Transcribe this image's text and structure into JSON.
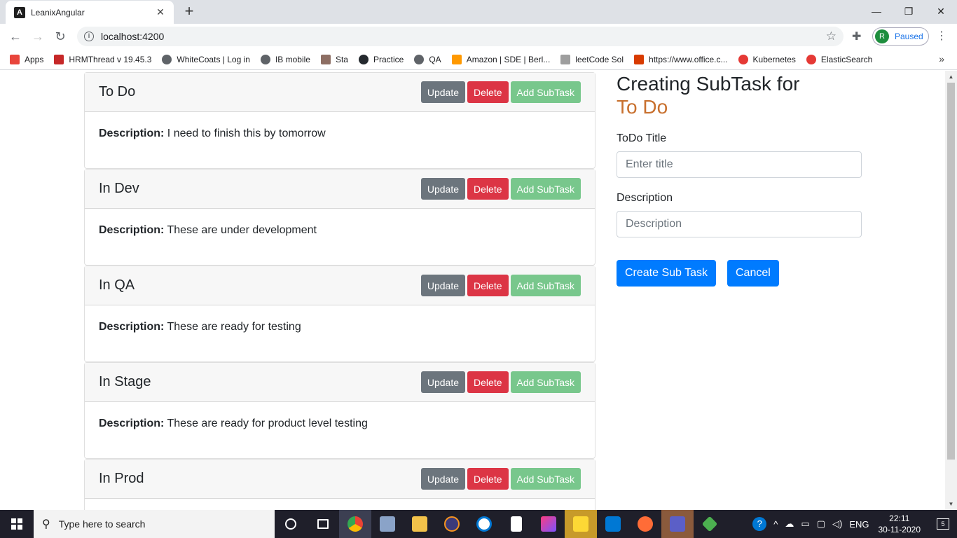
{
  "browser": {
    "tab_title": "LeanixAngular",
    "tab_favicon": "A",
    "url": "localhost:4200",
    "profile_initial": "R",
    "profile_status": "Paused",
    "bookmarks": [
      {
        "label": "Apps",
        "icon": "apps-grid-icon",
        "color": "#e8453c"
      },
      {
        "label": "HRMThread v 19.45.3",
        "icon": "hrm-icon",
        "color": "#c62828"
      },
      {
        "label": "WhiteCoats | Log in",
        "icon": "globe-icon",
        "color": "#5f6368"
      },
      {
        "label": "IB mobile",
        "icon": "globe-icon",
        "color": "#5f6368"
      },
      {
        "label": "Sta",
        "icon": "image-icon",
        "color": "#8d6e63"
      },
      {
        "label": "Practice",
        "icon": "github-icon",
        "color": "#24292e"
      },
      {
        "label": "QA",
        "icon": "globe-icon",
        "color": "#5f6368"
      },
      {
        "label": "Amazon | SDE | Berl...",
        "icon": "amazon-icon",
        "color": "#ff9900"
      },
      {
        "label": "leetCode Sol",
        "icon": "chart-icon",
        "color": "#9e9e9e"
      },
      {
        "label": "https://www.office.c...",
        "icon": "office-icon",
        "color": "#d83b01"
      },
      {
        "label": "Kubernetes",
        "icon": "youtube-icon",
        "color": "#e53935"
      },
      {
        "label": "ElasticSearch",
        "icon": "youtube-icon",
        "color": "#e53935"
      }
    ]
  },
  "cards": [
    {
      "title": "To Do",
      "description": "I need to finish this by tomorrow"
    },
    {
      "title": "In Dev",
      "description": "These are under development"
    },
    {
      "title": "In QA",
      "description": "These are ready for testing"
    },
    {
      "title": "In Stage",
      "description": "These are ready for product level testing"
    },
    {
      "title": "In Prod",
      "description": ""
    }
  ],
  "card_buttons": {
    "update": "Update",
    "delete": "Delete",
    "add_subtask": "Add SubTask"
  },
  "description_label": "Description:",
  "form": {
    "heading": "Creating SubTask for",
    "parent_title": "To Do",
    "title_label": "ToDo Title",
    "title_placeholder": "Enter title",
    "description_label": "Description",
    "description_placeholder": "Description",
    "create_button": "Create Sub Task",
    "cancel_button": "Cancel"
  },
  "taskbar": {
    "search_placeholder": "Type here to search",
    "language": "ENG",
    "time": "22:11",
    "date": "30-11-2020",
    "notification_count": "5"
  },
  "colors": {
    "accent_orange": "#c8702e",
    "primary": "#007bff",
    "danger": "#dc3545",
    "secondary": "#6c757d",
    "success_light": "#78c78c"
  }
}
